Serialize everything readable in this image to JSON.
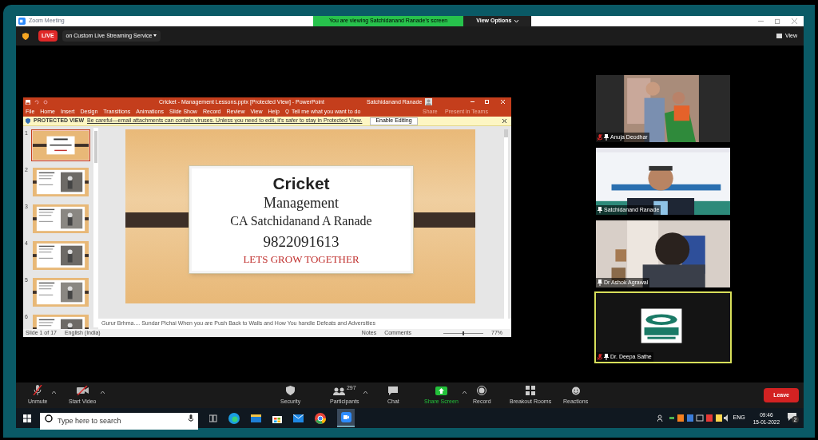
{
  "zoom": {
    "title": "Zoom Meeting",
    "banner": "You are viewing Satchidanand Ranade's screen",
    "view_options": "View Options",
    "live_badge": "LIVE",
    "streaming": "on Custom Live Streaming Service",
    "view": "View"
  },
  "powerpoint": {
    "title": "Cricket - Management Lessons.pptx [Protected View] - PowerPoint",
    "user": "Satchidanand Ranade",
    "menu": [
      {
        "label": "File"
      },
      {
        "label": "Home"
      },
      {
        "label": "Insert"
      },
      {
        "label": "Design"
      },
      {
        "label": "Transitions"
      },
      {
        "label": "Animations"
      },
      {
        "label": "Slide Show"
      },
      {
        "label": "Record"
      },
      {
        "label": "Review"
      },
      {
        "label": "View"
      },
      {
        "label": "Help"
      }
    ],
    "tell_me": "Tell me what you want to do",
    "share": "Share",
    "present": "Present in Teams",
    "protected": {
      "label": "PROTECTED VIEW",
      "message": "Be careful—email attachments can contain viruses. Unless you need to edit, it's safer to stay in Protected View.",
      "button": "Enable Editing"
    },
    "thumbnails": [
      {
        "number": "1",
        "selected": true
      },
      {
        "number": "2",
        "selected": false
      },
      {
        "number": "3",
        "selected": false
      },
      {
        "number": "4",
        "selected": false
      },
      {
        "number": "5",
        "selected": false
      },
      {
        "number": "6",
        "selected": false
      }
    ],
    "slide": {
      "title": "Cricket",
      "subtitle": "Management",
      "author": "CA Satchidanand A Ranade",
      "phone": "9822091613",
      "tagline": "LETS GROW TOGETHER"
    },
    "notes": "Gurur  Brhma.... Sundar Pichai When you are Push Back to Walls and How You handle Defeats and Adversities",
    "status": {
      "slide": "Slide 1 of 17",
      "language": "English (India)",
      "notes": "Notes",
      "comments": "Comments",
      "zoom": "77%"
    },
    "zoom_slider": {
      "level": 0.5
    }
  },
  "participants": [
    {
      "name": "Anuja Deodhar",
      "muted": true,
      "speaking": false
    },
    {
      "name": "Satchidanand Ranade",
      "muted": false,
      "speaking": false
    },
    {
      "name": "Dr Ashok Agrawal",
      "muted": false,
      "speaking": false
    },
    {
      "name": "Dr. Deepa Sathe",
      "muted": true,
      "speaking": true
    }
  ],
  "toolbar": [
    {
      "kind": "mic",
      "label": "Unmute"
    },
    {
      "kind": "video",
      "label": "Start Video"
    },
    {
      "kind": "security",
      "label": "Security"
    },
    {
      "kind": "participants",
      "label": "Participants",
      "count": "297"
    },
    {
      "kind": "chat",
      "label": "Chat"
    },
    {
      "kind": "share",
      "label": "Share Screen"
    },
    {
      "kind": "record",
      "label": "Record"
    },
    {
      "kind": "breakout",
      "label": "Breakout Rooms"
    },
    {
      "kind": "reactions",
      "label": "Reactions"
    }
  ],
  "leave": "Leave",
  "taskbar": {
    "search_placeholder": "Type here to search",
    "language": "ENG",
    "time": "09:46",
    "date": "15-01-2022",
    "notifications": "2"
  }
}
